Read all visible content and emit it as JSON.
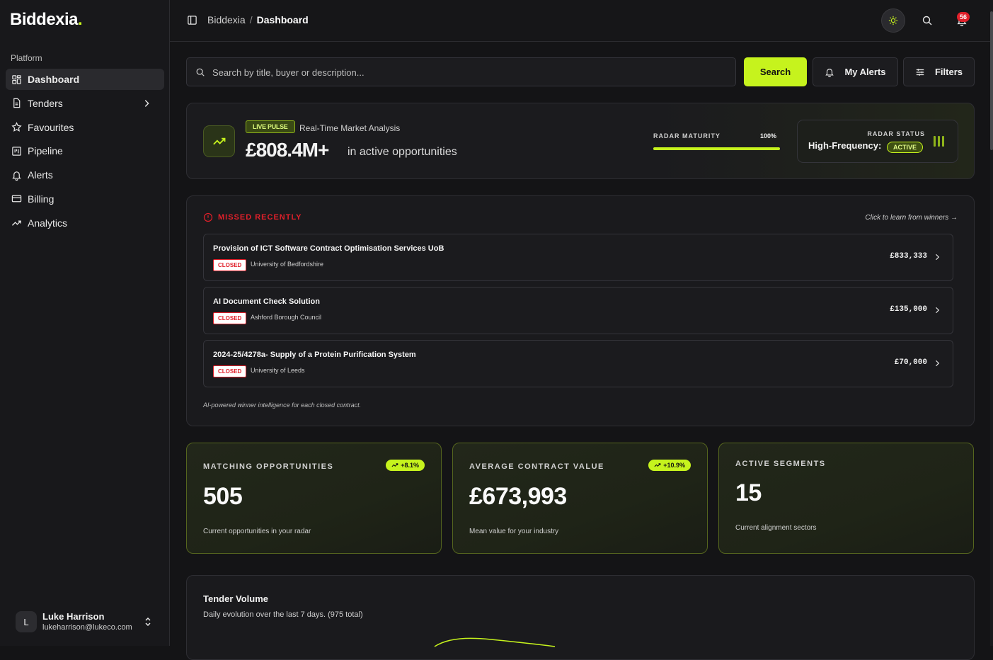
{
  "app": {
    "brand": "Biddexia",
    "brand_dot": "."
  },
  "sidebar": {
    "section": "Platform",
    "items": [
      {
        "label": "Dashboard",
        "icon": "dashboard-icon"
      },
      {
        "label": "Tenders",
        "icon": "document-icon"
      },
      {
        "label": "Favourites",
        "icon": "star-icon"
      },
      {
        "label": "Pipeline",
        "icon": "pipeline-icon"
      },
      {
        "label": "Alerts",
        "icon": "bell-icon"
      },
      {
        "label": "Billing",
        "icon": "credit-card-icon"
      },
      {
        "label": "Analytics",
        "icon": "trend-icon"
      }
    ],
    "user": {
      "initial": "L",
      "name": "Luke Harrison",
      "email": "lukeharrison@lukeco.com"
    }
  },
  "topbar": {
    "breadcrumb_root": "Biddexia",
    "breadcrumb_sep": "/",
    "breadcrumb_current": "Dashboard",
    "notification_count": "56"
  },
  "search": {
    "placeholder": "Search by title, buyer or description...",
    "search_label": "Search",
    "alerts_label": "My Alerts",
    "filters_label": "Filters"
  },
  "pulse": {
    "badge": "LIVE PULSE",
    "subtitle": "Real-Time Market Analysis",
    "amount": "£808.4M+",
    "amount_sub": "in active opportunities",
    "maturity_label": "RADAR MATURITY",
    "maturity_value": "100%",
    "maturity_fraction": 1.0,
    "status_label": "RADAR STATUS",
    "status_value": "High-Frequency:",
    "status_pill": "ACTIVE"
  },
  "missed": {
    "title": "MISSED RECENTLY",
    "learn_link": "Click to learn from winners →",
    "footer": "AI-powered winner intelligence for each closed contract.",
    "rows": [
      {
        "title": "Provision of ICT Software Contract Optimisation Services UoB",
        "status": "CLOSED",
        "buyer": "University of Bedfordshire",
        "value": "£833,333"
      },
      {
        "title": "AI Document Check Solution",
        "status": "CLOSED",
        "buyer": "Ashford Borough Council",
        "value": "£135,000"
      },
      {
        "title": "2024-25/4278a- Supply of a Protein Purification System",
        "status": "CLOSED",
        "buyer": "University of Leeds",
        "value": "£70,000"
      }
    ]
  },
  "stats": [
    {
      "label": "MATCHING OPPORTUNITIES",
      "value": "505",
      "sub": "Current opportunities in your radar",
      "trend": "+8.1%"
    },
    {
      "label": "AVERAGE CONTRACT VALUE",
      "value": "£673,993",
      "sub": "Mean value for your industry",
      "trend": "+10.9%"
    },
    {
      "label": "ACTIVE SEGMENTS",
      "value": "15",
      "sub": "Current alignment sectors",
      "trend": ""
    }
  ],
  "volume": {
    "title": "Tender Volume",
    "subtitle": "Daily evolution over the last 7 days. (975 total)"
  },
  "colors": {
    "accent": "#c6f31d",
    "danger": "#e0202a",
    "background": "#141416"
  }
}
